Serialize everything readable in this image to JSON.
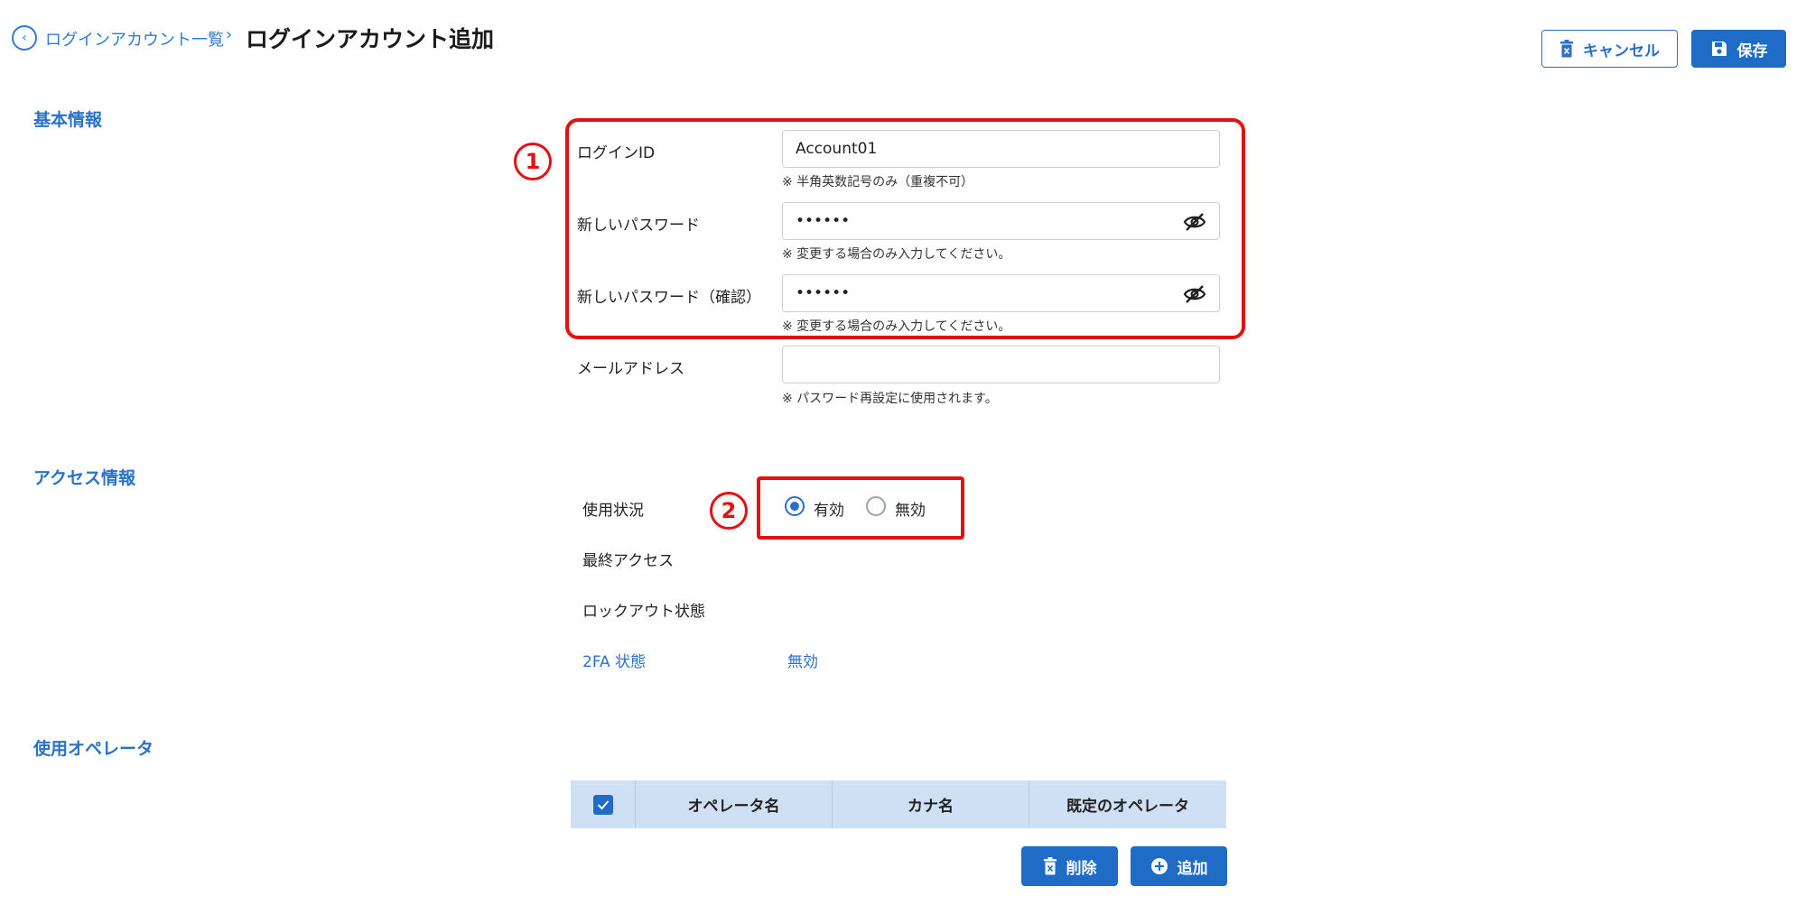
{
  "header": {
    "back_icon": "chevron-left-icon",
    "breadcrumb_link": "ログインアカウント一覧",
    "breadcrumb_sep": "›",
    "title": "ログインアカウント追加",
    "cancel_label": "キャンセル",
    "save_label": "保存"
  },
  "sections": {
    "basic": "基本情報",
    "access": "アクセス情報",
    "operators": "使用オペレータ"
  },
  "basic": {
    "login_id_label": "ログインID",
    "login_id_value": "Account01",
    "login_id_hint": "※ 半角英数記号のみ（重複不可）",
    "new_password_label": "新しいパスワード",
    "new_password_value": "••••••",
    "new_password_hint": "※ 変更する場合のみ入力してください。",
    "confirm_password_label": "新しいパスワード（確認）",
    "confirm_password_value": "••••••",
    "confirm_password_hint": "※ 変更する場合のみ入力してください。",
    "email_label": "メールアドレス",
    "email_value": "",
    "email_hint": "※ パスワード再設定に使用されます。"
  },
  "access": {
    "usage_label": "使用状況",
    "radio_enabled": "有効",
    "radio_disabled": "無効",
    "selected": "有効",
    "last_access_label": "最終アクセス",
    "last_access_value": "",
    "lockout_label": "ロックアウト状態",
    "lockout_value": "",
    "twofa_label": "2FA 状態",
    "twofa_value": "無効"
  },
  "annotations": {
    "one": "1",
    "two": "2"
  },
  "operators": {
    "columns": [
      "オペレータ名",
      "カナ名",
      "既定のオペレータ"
    ],
    "delete_label": "削除",
    "add_label": "追加"
  },
  "colors": {
    "accent": "#1f6cc6",
    "annotation": "#e21212",
    "table_header": "#cfe0f4"
  }
}
